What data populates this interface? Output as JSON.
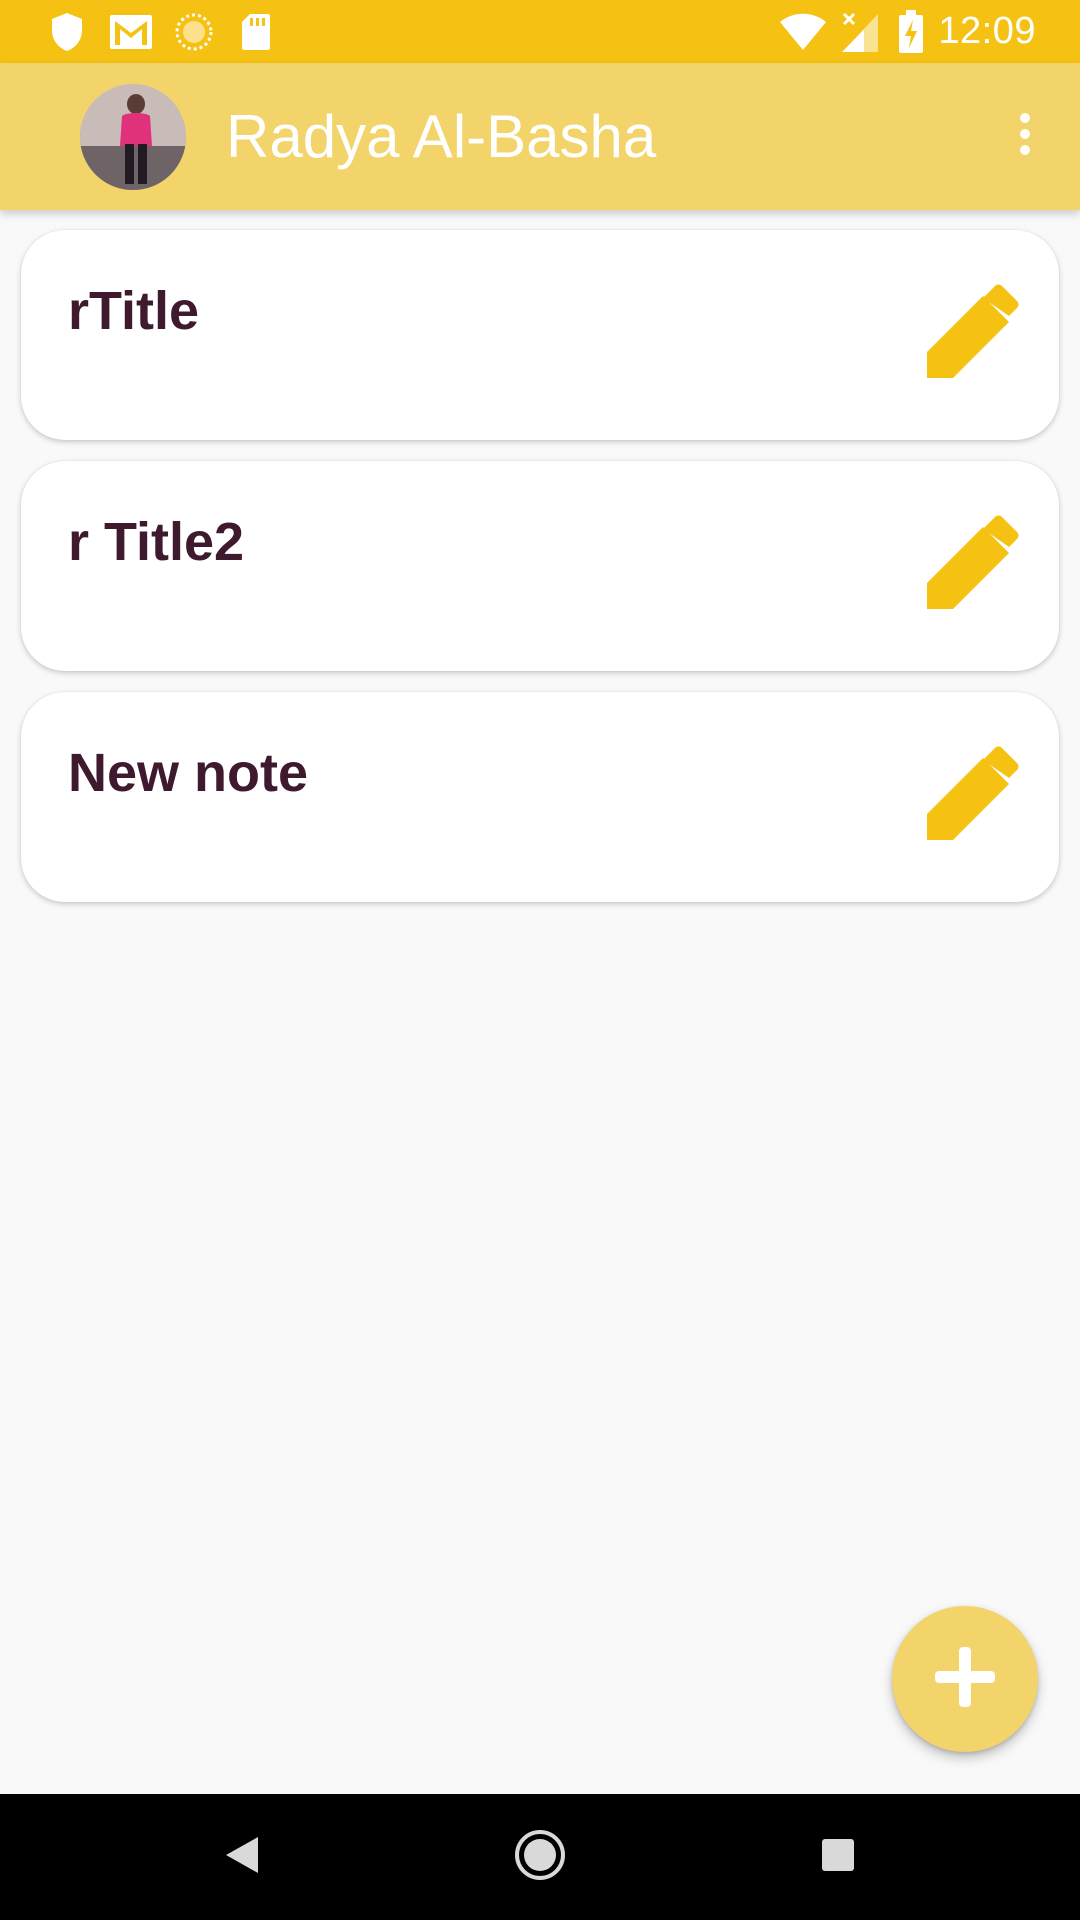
{
  "status_bar": {
    "time": "12:09",
    "left_icons": [
      "shield-icon",
      "gmail-icon",
      "sun-icon",
      "sd-card-icon"
    ],
    "right_icons": [
      "wifi-icon",
      "cell-signal-icon",
      "battery-charging-icon"
    ],
    "color": "#f5c112"
  },
  "app_bar": {
    "title": "Radya Al-Basha",
    "avatar": "user-avatar",
    "menu_icon": "more-vert-icon",
    "color": "#f2d46a"
  },
  "notes": [
    {
      "title": "rTitle"
    },
    {
      "title": "r Title2"
    },
    {
      "title": "New note"
    }
  ],
  "fab": {
    "icon": "plus-icon",
    "color": "#f2d46a"
  },
  "colors": {
    "accent": "#f5c112",
    "note_title": "#3f1a2e",
    "background": "#f9f9f9"
  },
  "nav_bar": {
    "buttons": [
      "back-icon",
      "home-icon",
      "recents-icon"
    ]
  }
}
